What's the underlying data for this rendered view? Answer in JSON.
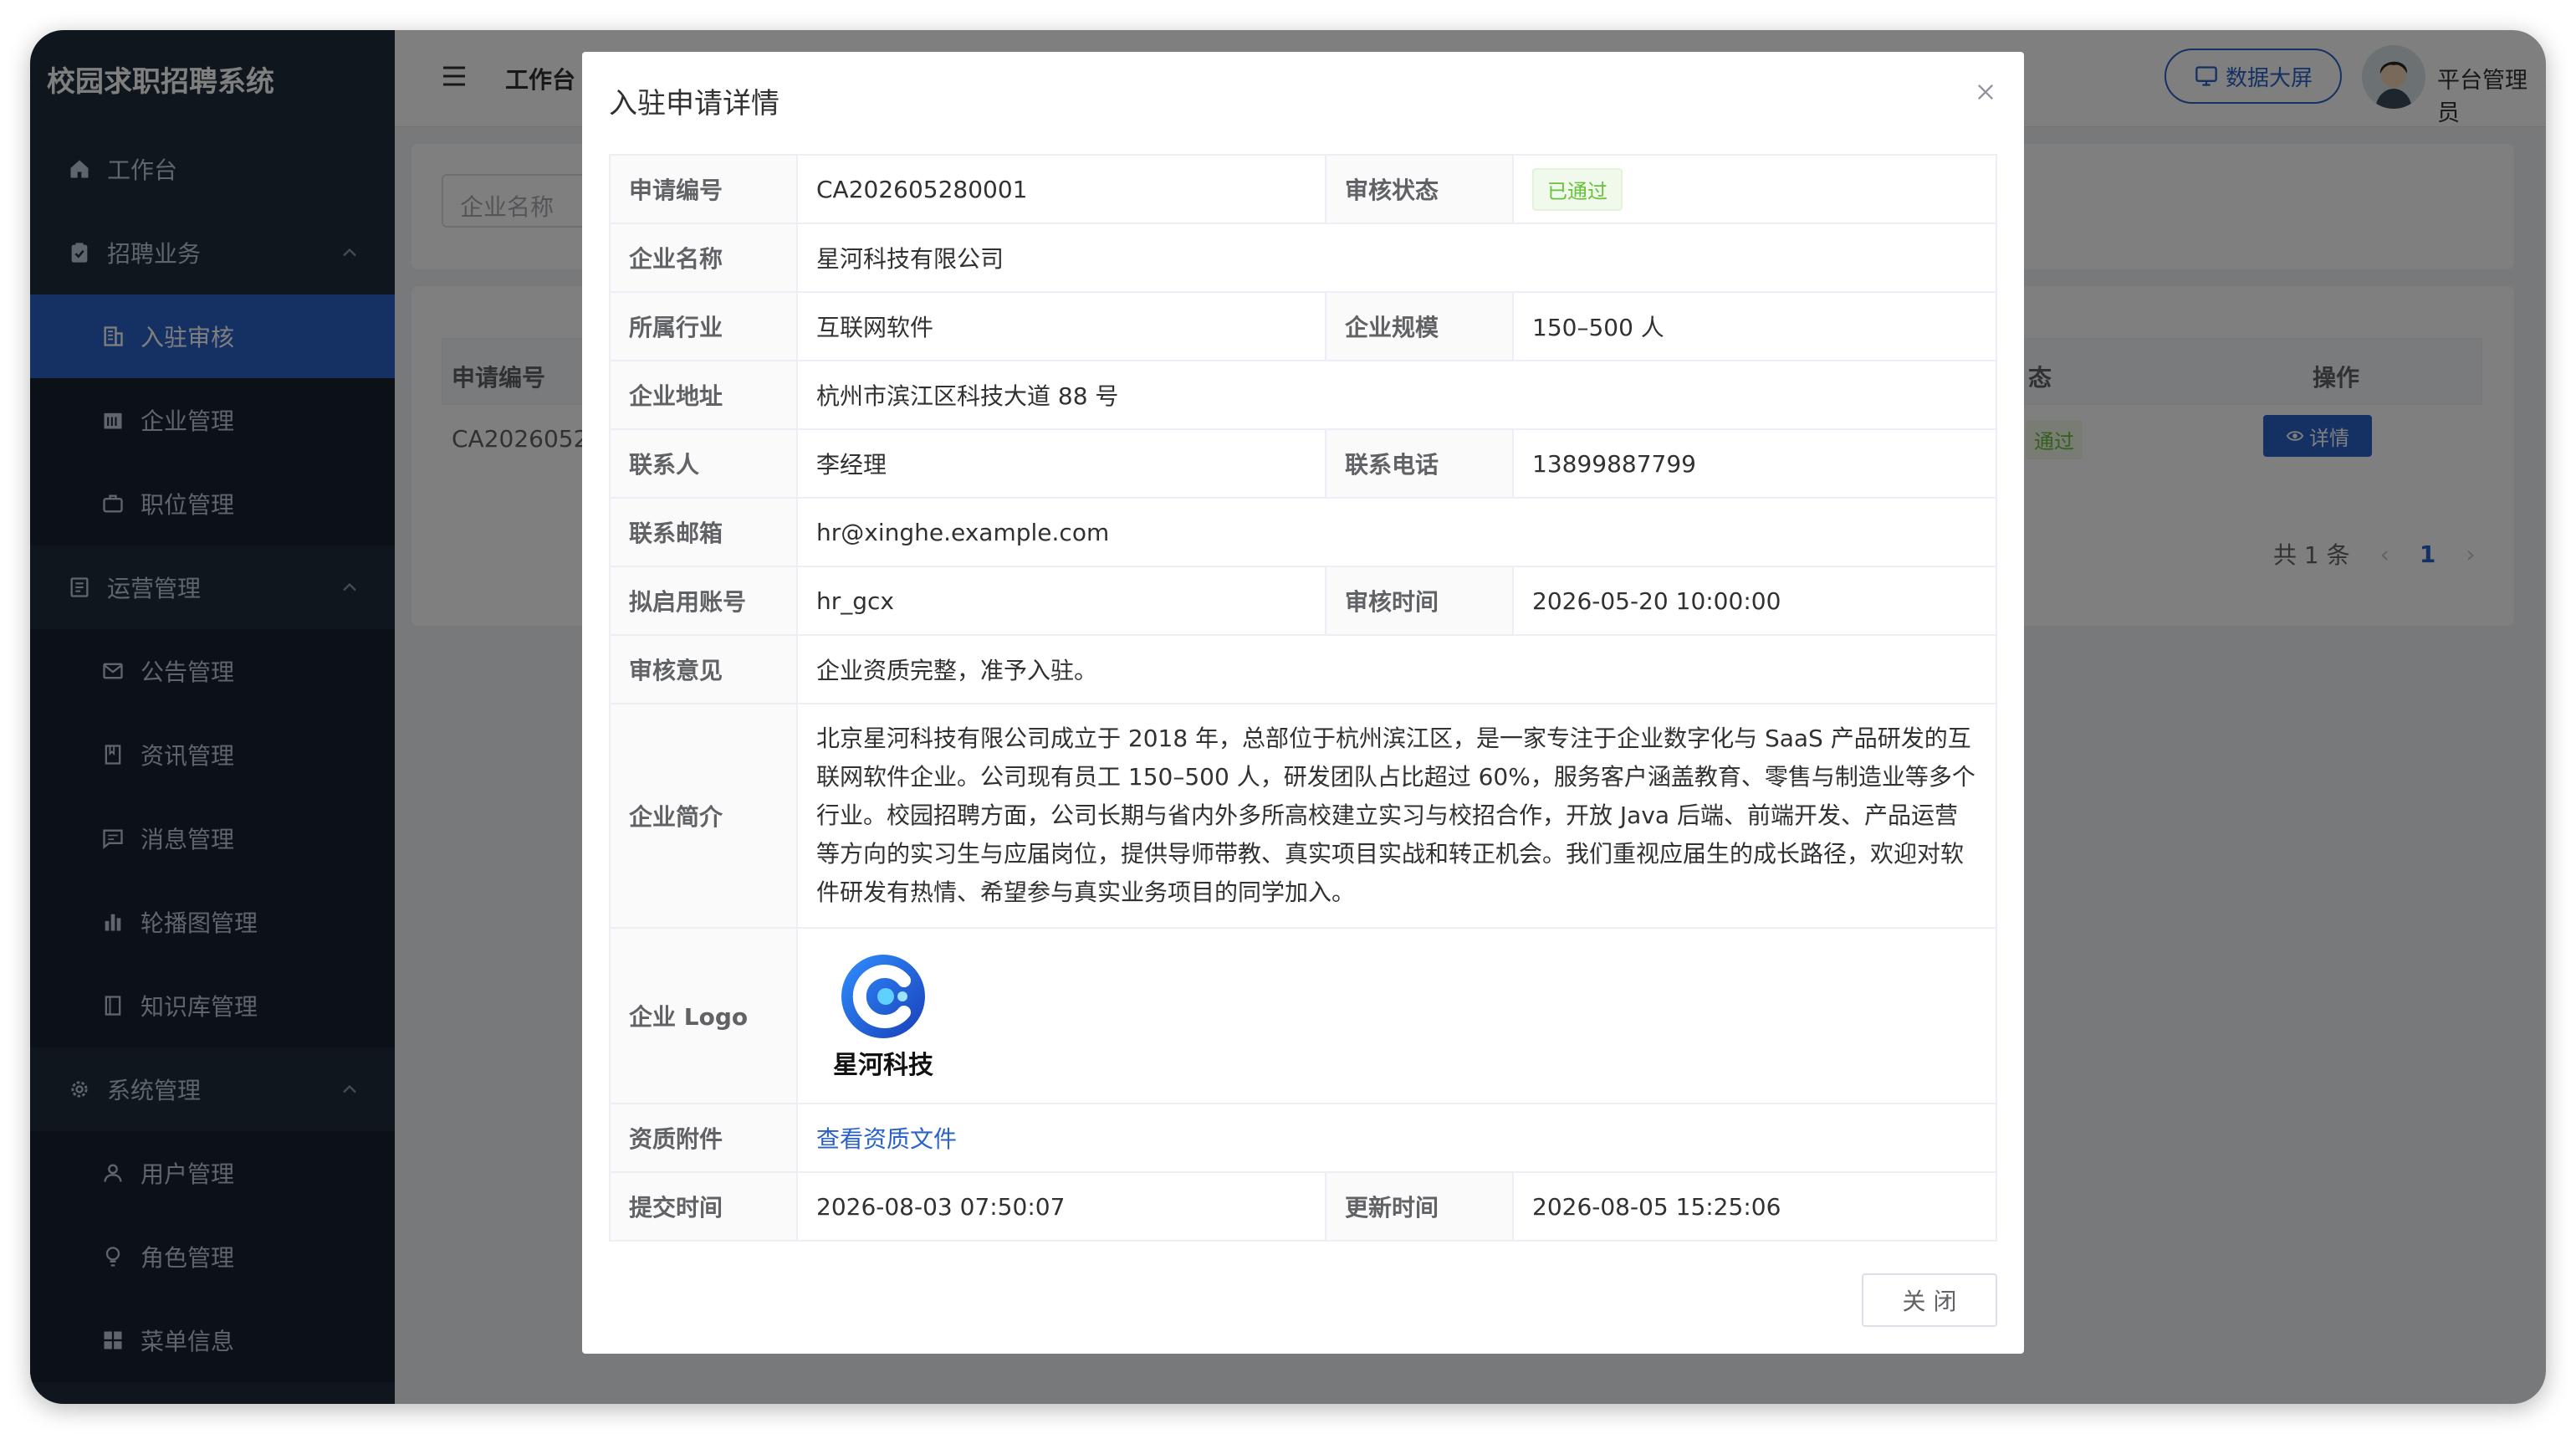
{
  "app": {
    "title": "校园求职招聘系统"
  },
  "sidebar": {
    "items": [
      {
        "label": "工作台"
      },
      {
        "label": "招聘业务"
      },
      {
        "label": "入驻审核"
      },
      {
        "label": "企业管理"
      },
      {
        "label": "职位管理"
      },
      {
        "label": "运营管理"
      },
      {
        "label": "公告管理"
      },
      {
        "label": "资讯管理"
      },
      {
        "label": "消息管理"
      },
      {
        "label": "轮播图管理"
      },
      {
        "label": "知识库管理"
      },
      {
        "label": "系统管理"
      },
      {
        "label": "用户管理"
      },
      {
        "label": "角色管理"
      },
      {
        "label": "菜单信息"
      }
    ]
  },
  "header": {
    "breadcrumb": "工作台",
    "screen_button": "数据大屏",
    "user": "平台管理员"
  },
  "background": {
    "search_placeholder": "企业名称",
    "table": {
      "col_id": "申请编号",
      "col_status": "态",
      "col_op": "操作",
      "row_id": "CA2026052",
      "row_status": "通过",
      "detail_button": "详情"
    },
    "pager": {
      "total": "共 1 条",
      "page": "1"
    }
  },
  "dialog": {
    "title": "入驻申请详情",
    "labels": {
      "app_no": "申请编号",
      "status": "审核状态",
      "company": "企业名称",
      "industry": "所属行业",
      "scale": "企业规模",
      "address": "企业地址",
      "contact": "联系人",
      "phone": "联系电话",
      "email": "联系邮箱",
      "account": "拟启用账号",
      "review_time": "审核时间",
      "opinion": "审核意见",
      "intro": "企业简介",
      "logo": "企业 Logo",
      "attachment": "资质附件",
      "submit_time": "提交时间",
      "update_time": "更新时间"
    },
    "values": {
      "app_no": "CA202605280001",
      "status": "已通过",
      "company": "星河科技有限公司",
      "industry": "互联网软件",
      "scale": "150–500 人",
      "address": "杭州市滨江区科技大道 88 号",
      "contact": "李经理",
      "phone": "13899887799",
      "email": "hr@xinghe.example.com",
      "account": "hr_gcx",
      "review_time": "2026-05-20 10:00:00",
      "opinion": "企业资质完整，准予入驻。",
      "intro": "北京星河科技有限公司成立于 2018 年，总部位于杭州滨江区，是一家专注于企业数字化与 SaaS 产品研发的互联网软件企业。公司现有员工 150–500 人，研发团队占比超过 60%，服务客户涵盖教育、零售与制造业等多个行业。校园招聘方面，公司长期与省内外多所高校建立实习与校招合作，开放 Java 后端、前端开发、产品运营等方向的实习生与应届岗位，提供导师带教、真实项目实战和转正机会。我们重视应届生的成长路径，欢迎对软件研发有热情、希望参与真实业务项目的同学加入。",
      "logo_name": "星河科技",
      "attachment": "查看资质文件",
      "submit_time": "2026-08-03 07:50:07",
      "update_time": "2026-08-05 15:25:06"
    },
    "close_button": "关 闭"
  },
  "colors": {
    "primary": "#2a62c9",
    "sidebar": "#1f2d3d",
    "success": "#67c23a"
  }
}
